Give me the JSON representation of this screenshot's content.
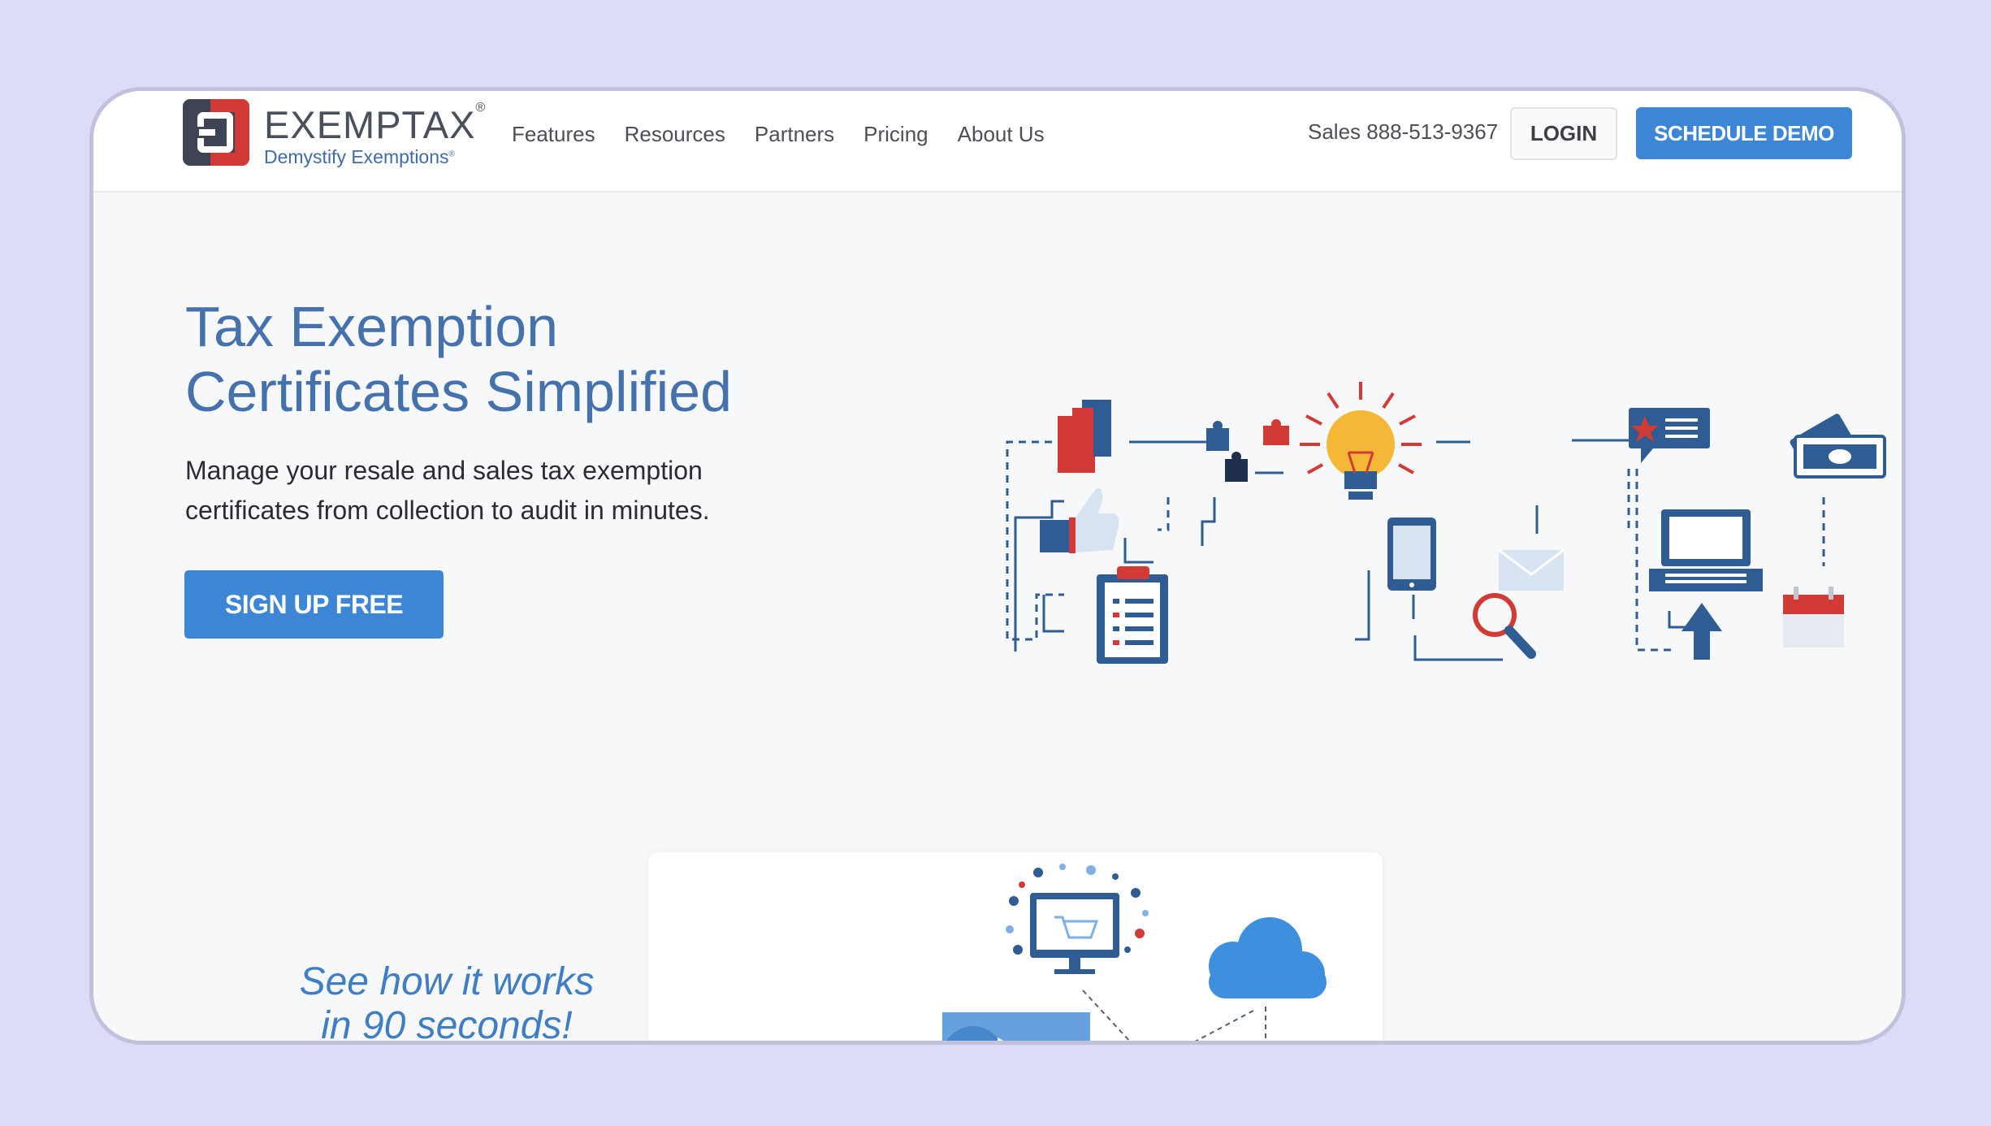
{
  "brand": {
    "name": "EXEMPTAX",
    "registered": "®",
    "tagline": "Demystify Exemptions",
    "tagline_mark": "®",
    "colors": {
      "primary_blue": "#3d86d6",
      "logo_red": "#d23a35",
      "logo_dark": "#3e4454",
      "heading_blue": "#4571ad"
    }
  },
  "nav": {
    "links": [
      "Features",
      "Resources",
      "Partners",
      "Pricing",
      "About Us"
    ],
    "sales": "Sales 888-513-9367",
    "login_label": "LOGIN",
    "demo_label": "SCHEDULE DEMO"
  },
  "hero": {
    "title_line1": "Tax Exemption",
    "title_line2": "Certificates Simplified",
    "subtitle": "Manage your resale and sales tax exemption certificates from collection to audit in minutes.",
    "cta_label": "SIGN UP FREE",
    "illustration_icons": [
      "document-icon",
      "puzzle-icon",
      "lightbulb-icon",
      "chat-icon",
      "money-icon",
      "thumbs-up-icon",
      "clipboard-icon",
      "phone-icon",
      "envelope-icon",
      "magnifier-icon",
      "laptop-icon",
      "upload-arrow-icon",
      "calendar-icon"
    ]
  },
  "video": {
    "callout_line1": "See how it works",
    "callout_line2": "in 90 seconds!",
    "play_icon": "play-icon"
  }
}
